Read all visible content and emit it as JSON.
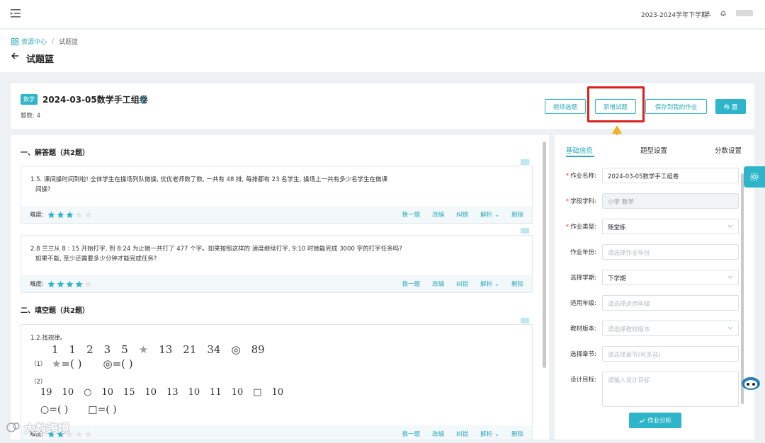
{
  "topbar": {
    "term": "2023-2024学年下学期"
  },
  "breadcrumb": {
    "root": "资源中心",
    "sep": "/",
    "current": "试题篮"
  },
  "page": {
    "title": "试题篮"
  },
  "paper": {
    "subject_tag": "数学",
    "title": "2024-03-05数学手工组卷",
    "count": "题数: 4",
    "buttons": {
      "continue": "继续选题",
      "new": "新增试题",
      "save": "保存到我的作业",
      "assign": "布 置"
    }
  },
  "sections": [
    {
      "title": "一、解答题（共2题）"
    },
    {
      "title": "二、填空题（共2题）"
    }
  ],
  "questions": [
    {
      "text1": "1.5. 课间操时间到啦! 全体学生在操场列队做操, 优优老师数了数, 一共有 48 排, 每排都有 23 名学生, 操场上一共有多少名学生在做课",
      "text2": "间操?",
      "stars": 3
    },
    {
      "text1": "2.8 兰兰从 8 : 15 开始打字, 到 8:24 为止她一共打了 477 个字。如果按照这样的 速度继续打字, 9:10 时她能完成 3000 字的打字任务吗?",
      "text2": "如果不能, 至少还需要多少分钟才能完成任务?",
      "stars": 4
    },
    {
      "text1": "1.2.找规律。",
      "stars": 2
    }
  ],
  "pattern": {
    "row1": [
      "1",
      "1",
      "2",
      "3",
      "5",
      "★",
      "13",
      "21",
      "34",
      "◎",
      "89"
    ],
    "row2_label": "（1）",
    "row3_label": "（2）",
    "row4": [
      "19",
      "10",
      "○",
      "10",
      "15",
      "10",
      "13",
      "10",
      "11",
      "10",
      "□",
      "10"
    ],
    "eq_paren": "=(        )"
  },
  "qfoot": {
    "difficulty": "难度:",
    "swap": "换一题",
    "edit": "改编",
    "correct": "纠错",
    "analysis": "解析",
    "delete": "删除"
  },
  "tabs": {
    "basic": "基础信息",
    "type": "题型设置",
    "score": "分数设置"
  },
  "form": {
    "name": {
      "label": "作业名称:",
      "value": "2024-03-05数学手工组卷",
      "required": true
    },
    "subject": {
      "label": "学段学科:",
      "value": "小学 数学",
      "required": true
    },
    "type": {
      "label": "作业类型:",
      "value": "随堂练",
      "required": true
    },
    "year": {
      "label": "作业年份:",
      "placeholder": "请选择作业年份"
    },
    "term": {
      "label": "选择学期:",
      "value": "下学期"
    },
    "grade": {
      "label": "适用年级:",
      "placeholder": "请选择适用年级"
    },
    "edition": {
      "label": "教材版本:",
      "placeholder": "请选择教材版本"
    },
    "chapter": {
      "label": "选择章节:",
      "placeholder": "请选择章节(可多选)"
    },
    "goal": {
      "label": "设计目标:",
      "placeholder": "请输入设计目标"
    }
  },
  "analyze": "作业分析",
  "watermark": "大数跨境",
  "colors": {
    "accent": "#2fb5c9",
    "highlight": "#d8201d",
    "arrow": "#f0b323"
  }
}
